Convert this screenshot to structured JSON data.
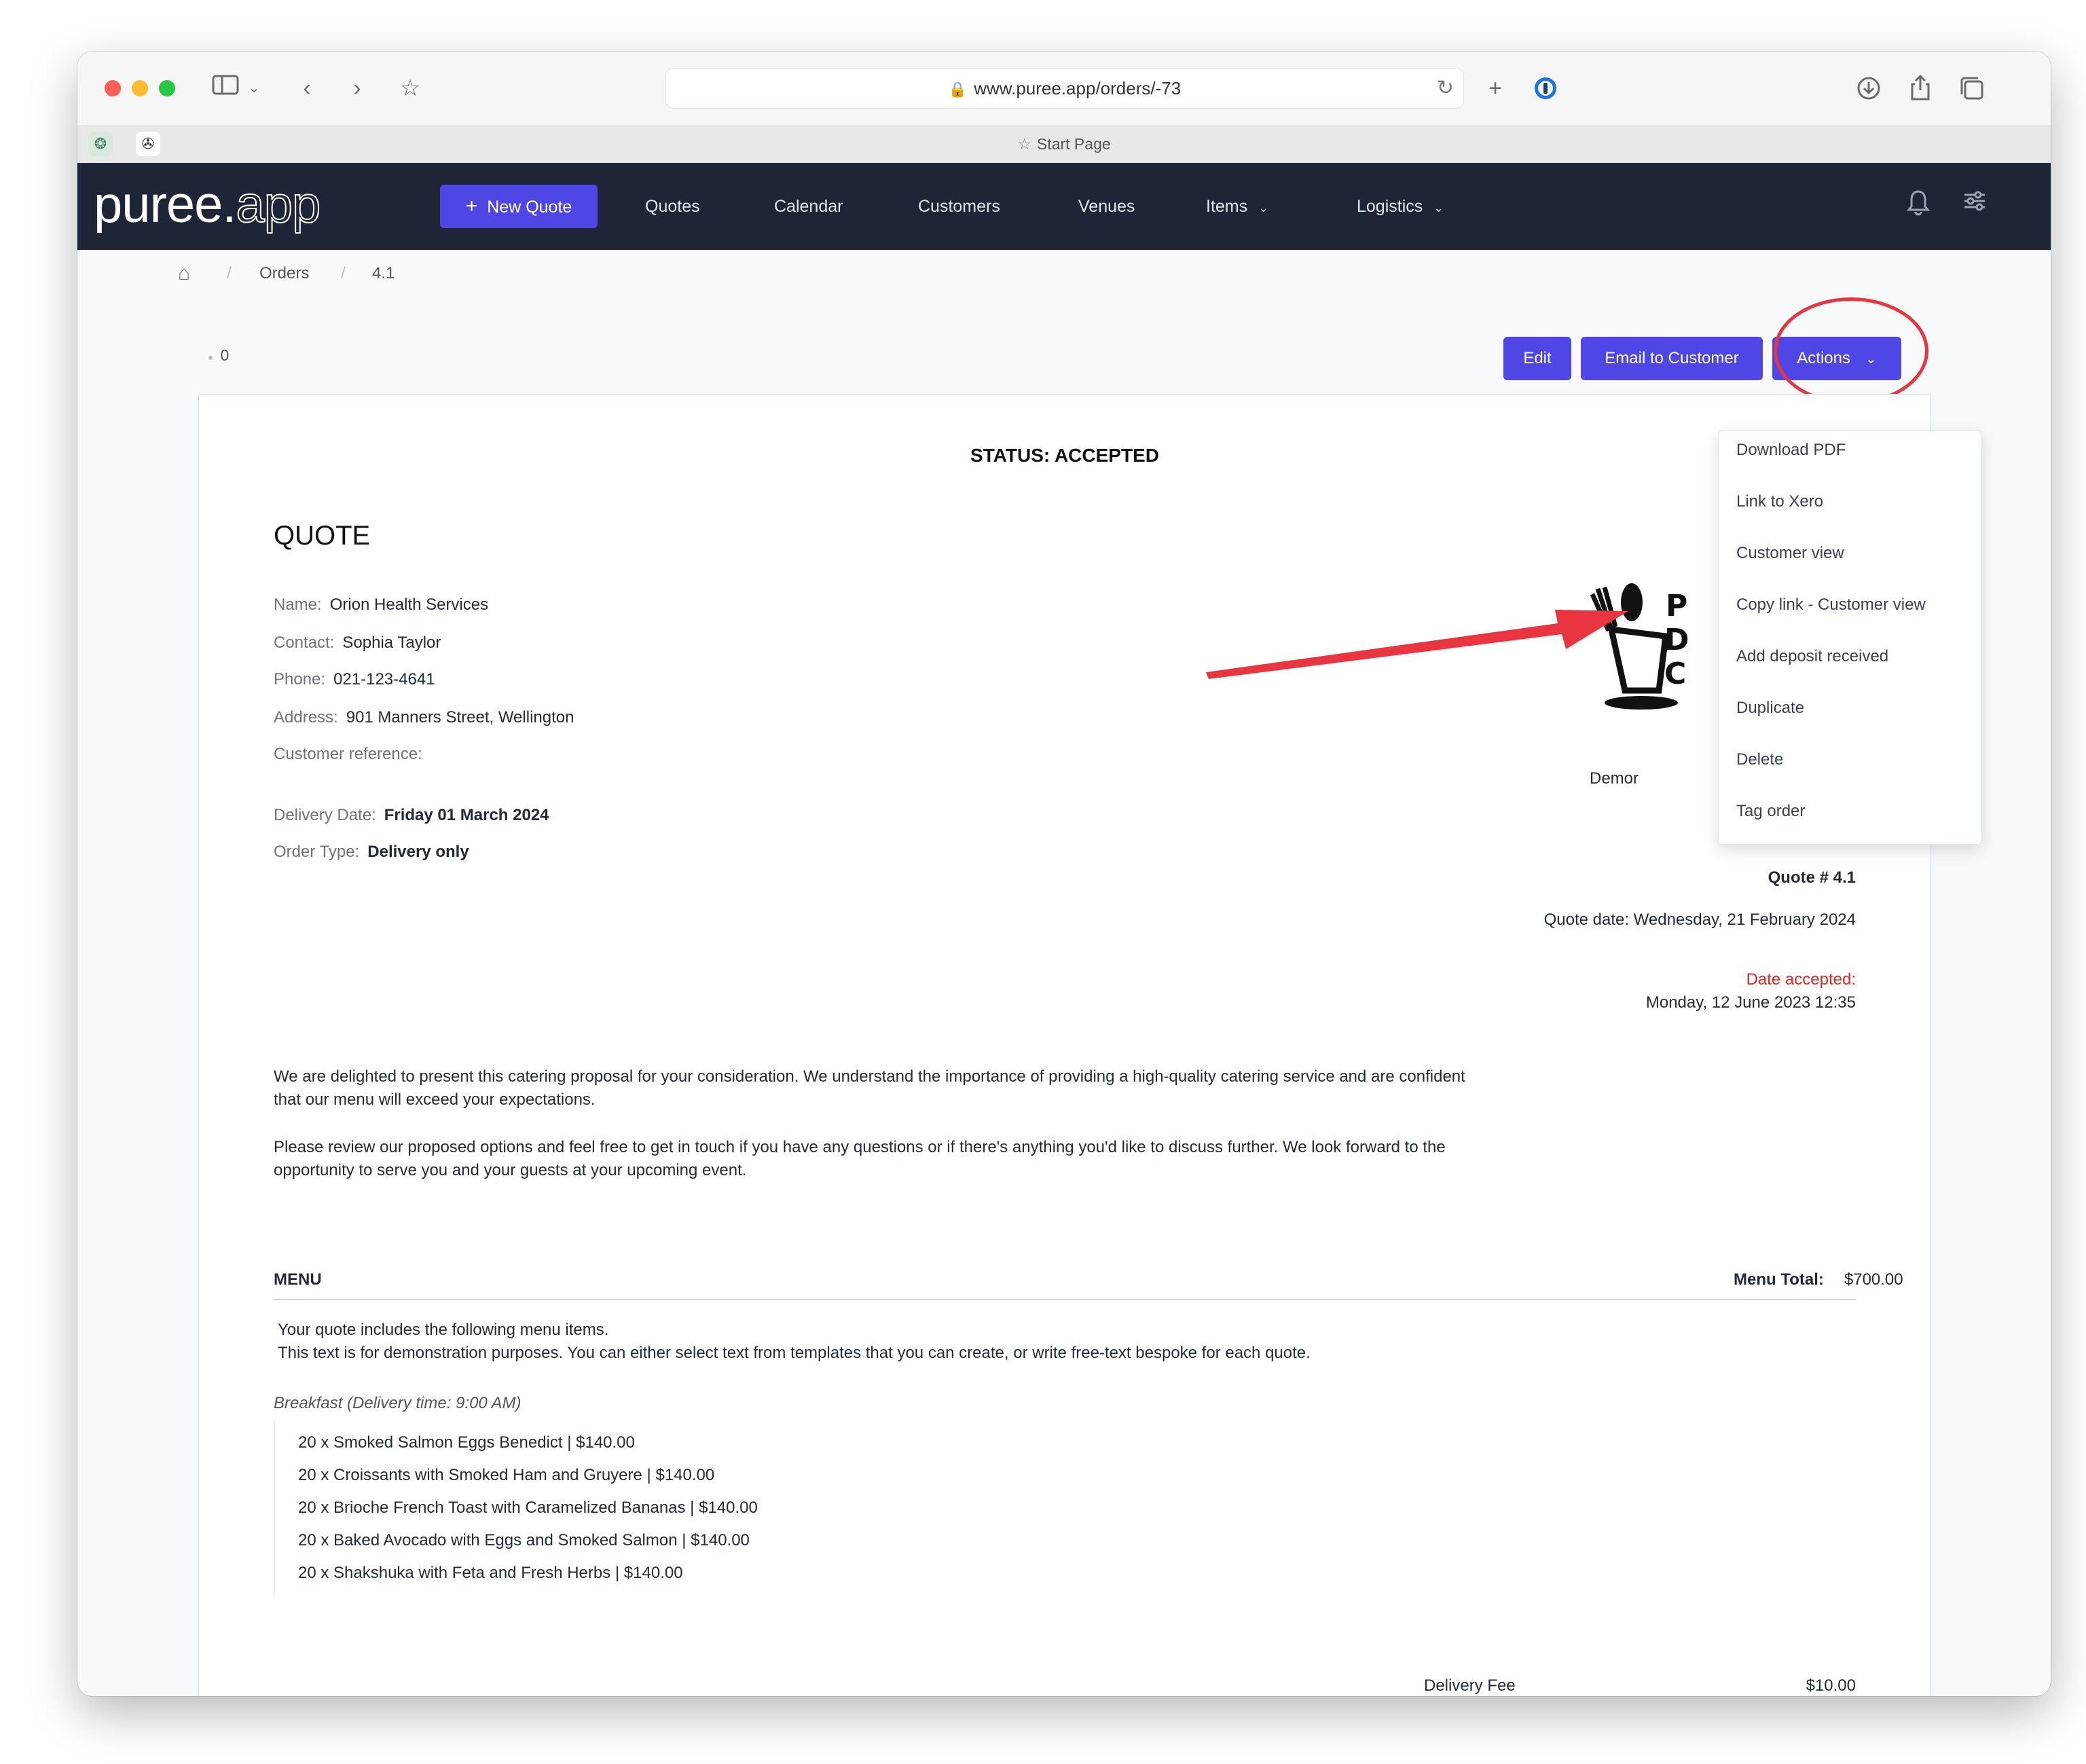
{
  "browser": {
    "url": "www.puree.app/orders/-73",
    "start_page_label": "Start Page"
  },
  "nav": {
    "logo_main": "puree",
    "logo_dot": ".",
    "logo_tail": "app",
    "new_quote_label": "New Quote",
    "links": [
      "Quotes",
      "Calendar",
      "Customers",
      "Venues",
      "Items",
      "Logistics"
    ]
  },
  "breadcrumb": {
    "sep": "/",
    "items": [
      "Orders",
      "4.1"
    ]
  },
  "toolbar": {
    "count": "0",
    "edit_label": "Edit",
    "email_label": "Email to Customer",
    "actions_label": "Actions"
  },
  "actions_menu": [
    "Download PDF",
    "Link to Xero",
    "Customer view",
    "Copy link - Customer view",
    "Add deposit received",
    "Duplicate",
    "Delete",
    "Tag order"
  ],
  "quote": {
    "status": "STATUS: ACCEPTED",
    "heading": "QUOTE",
    "name_label": "Name:",
    "name": "Orion Health Services",
    "contact_label": "Contact:",
    "contact": "Sophia Taylor",
    "phone_label": "Phone:",
    "phone": "021-123-4641",
    "address_label": "Address:",
    "address": "901 Manners Street, Wellington",
    "customer_ref_label": "Customer reference:",
    "delivery_date_label": "Delivery Date:",
    "delivery_date": "Friday 01 March 2024",
    "order_type_label": "Order Type:",
    "order_type": "Delivery only",
    "company_partial": "Demor",
    "quote_number": "Quote # 4.1",
    "quote_date": "Quote date: Wednesday, 21 February 2024",
    "date_accepted_label": "Date accepted:",
    "date_accepted": "Monday, 12 June 2023 12:35",
    "intro_1": "We are delighted to present this catering proposal for your consideration. We understand the importance of providing a high-quality catering service and are confident that our menu will exceed your expectations.",
    "intro_2": "Please review our proposed options and feel free to get in touch if you have any questions or if there's anything you'd like to discuss further. We look forward to the opportunity to serve you and your guests at your upcoming event.",
    "menu_heading": "MENU",
    "menu_total_label": "Menu Total:",
    "menu_total": "$700.00",
    "menu_note_1": "Your quote includes the following menu items.",
    "menu_note_2": "This text is for demonstration purposes. You can either select text from templates that you can create, or write free-text bespoke for each quote.",
    "section_label": "Breakfast (Delivery time: 9:00 AM)",
    "items": [
      "20 x Smoked Salmon Eggs Benedict | $140.00",
      "20 x Croissants with Smoked Ham and Gruyere | $140.00",
      "20 x Brioche French Toast with Caramelized Bananas | $140.00",
      "20 x Baked Avocado with Eggs and Smoked Salmon | $140.00",
      "20 x Shakshuka with Feta and Fresh Herbs | $140.00"
    ],
    "delivery_fee_label": "Delivery Fee",
    "delivery_fee": "$10.00"
  },
  "colors": {
    "accent": "#4f46e5",
    "nav_bg": "#1e2536",
    "annotation_red": "#e8353f",
    "accepted_red": "#dc2626"
  }
}
